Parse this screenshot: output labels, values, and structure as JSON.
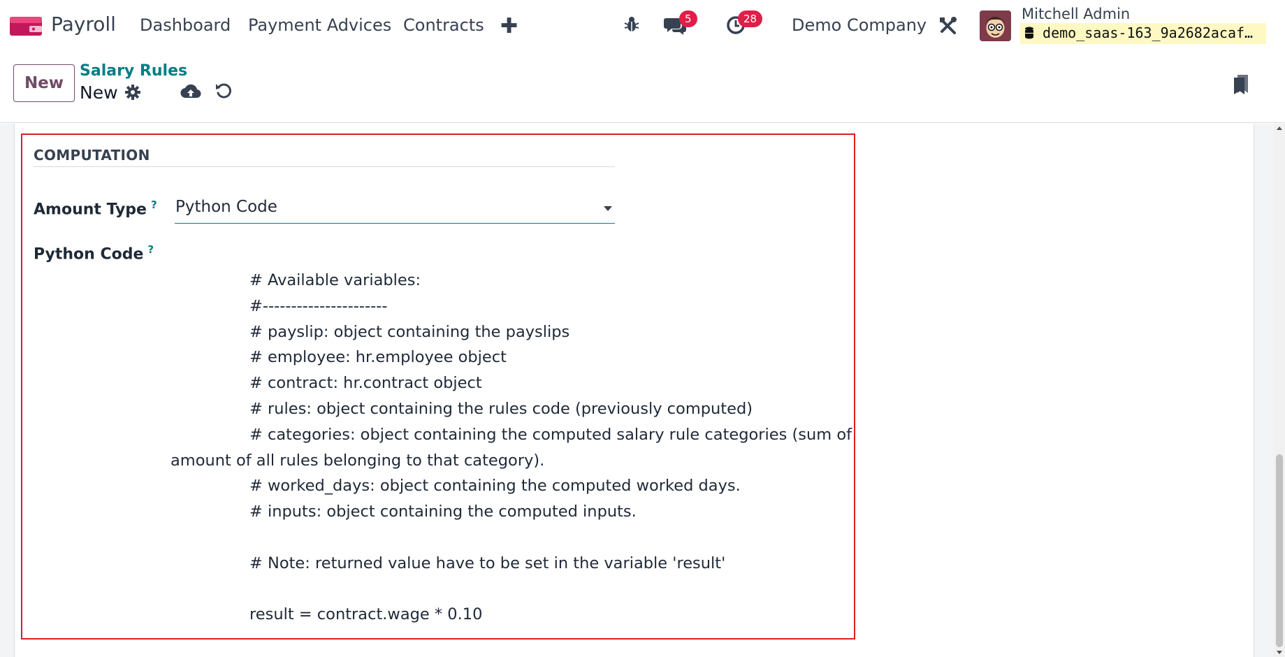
{
  "navbar": {
    "app_name": "Payroll",
    "menu": [
      "Dashboard",
      "Payment Advices",
      "Contracts"
    ],
    "messages_count": "5",
    "activities_count": "28",
    "company": "Demo Company",
    "user_name": "Mitchell Admin",
    "database": "demo_saas-163_9a2682acaf…"
  },
  "control": {
    "new_label": "New",
    "breadcrumb": "Salary Rules",
    "record_name": "New"
  },
  "form": {
    "section_title": "COMPUTATION",
    "amount_type_label": "Amount Type",
    "amount_type_value": "Python Code",
    "python_code_label": "Python Code",
    "help_mark": "?",
    "code_lines": [
      "# Available variables:",
      "#----------------------",
      "# payslip: object containing the payslips",
      "# employee: hr.employee object",
      "# contract: hr.contract object",
      "# rules: object containing the rules code (previously computed)",
      "# categories: object containing the computed salary rule categories (sum of",
      "amount of all rules belonging to that category).",
      "# worked_days: object containing the computed worked days.",
      "# inputs: object containing the computed inputs.",
      "",
      "# Note: returned value have to be set in the variable 'result'",
      "",
      "result = contract.wage * 0.10"
    ]
  },
  "colors": {
    "brand": "#714b67",
    "accent": "#017e84",
    "badge": "#e11d48",
    "highlight_border": "#e11d1d"
  }
}
